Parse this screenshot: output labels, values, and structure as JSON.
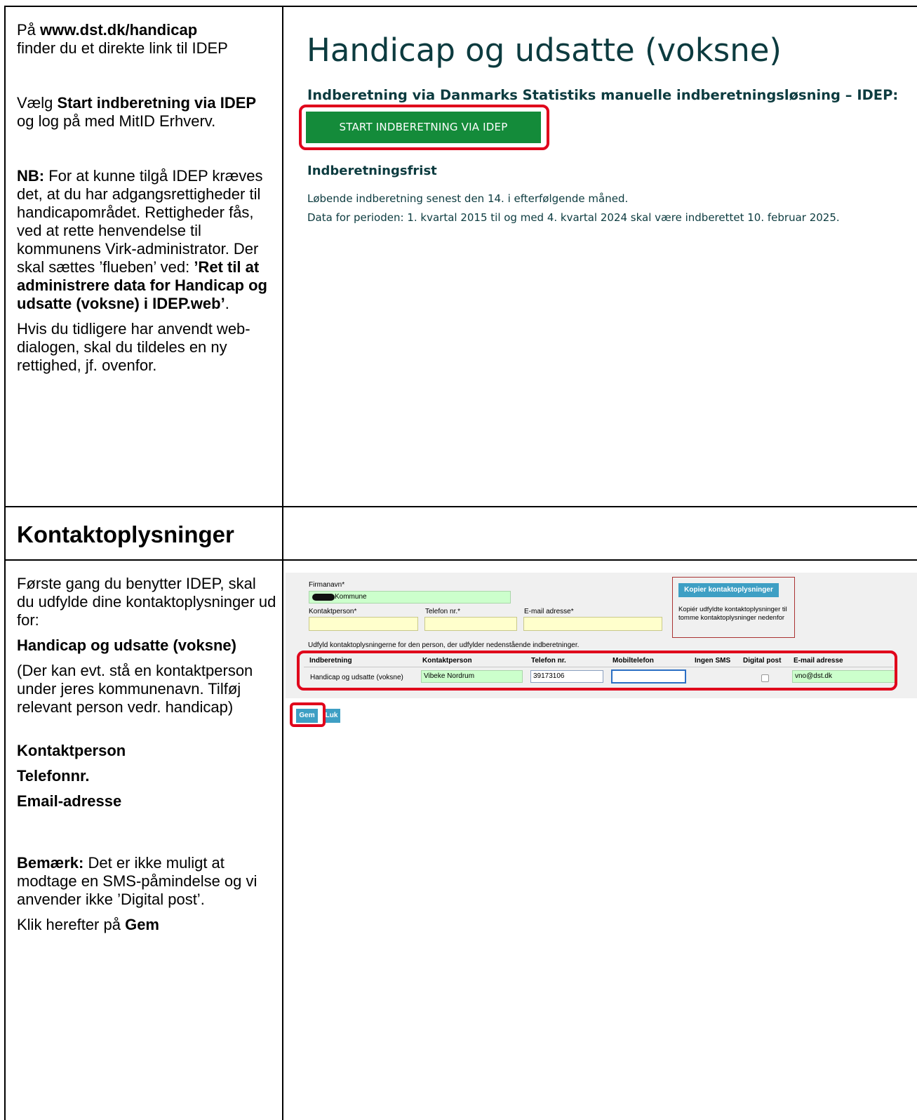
{
  "left_top": {
    "p1_prefix": "På ",
    "p1_url": "www.dst.dk/handicap",
    "p1_rest": "finder du et direkte link til IDEP",
    "p2_prefix": "Vælg ",
    "p2_bold": "Start indberetning via IDEP",
    "p2_rest": " og log på med MitID Erhverv.",
    "p3_bold": "NB:",
    "p3_text": " For at kunne tilgå IDEP kræves det, at du har adgangsrettigheder til handicapområdet. Rettigheder fås, ved at rette henvendelse til kommunens Virk-administrator. Der skal sættes ’flueben’ ved: ",
    "p3_bold2": "’Ret til at administrere data for Handicap og udsatte (voksne) i IDEP.web’",
    "p3_end": ".",
    "p4": "Hvis du tidligere har anvendt web-dialogen, skal du tildeles en ny rettighed, jf. ovenfor."
  },
  "section_heading": "Kontaktoplysninger",
  "left_bottom": {
    "p1": "Første gang du benytter IDEP, skal du udfylde dine kontaktoplysninger ud for:",
    "p2": "Handicap og udsatte (voksne)",
    "p3": "(Der kan evt. stå en kontaktperson under jeres kommunenavn. Tilføj relevant person vedr. handicap)",
    "f1": "Kontaktperson",
    "f2": "Telefonnr.",
    "f3": "Email-adresse",
    "p4_bold": "Bemærk:",
    "p4_text": " Det er ikke muligt at modtage en SMS-påmindelse og vi anvender ikke ’Digital post’.",
    "p5_prefix": "Klik herefter på ",
    "p5_bold": "Gem"
  },
  "web": {
    "title": "Handicap og udsatte (voksne)",
    "idep_heading": "Indberetning via Danmarks Statistiks manuelle indberetningsløsning – IDEP:",
    "start_button": "START INDBERETNING VIA IDEP",
    "frist_heading": "Indberetningsfrist",
    "frist_line1": "Løbende indberetning senest den 14. i efterfølgende måned.",
    "frist_line2": "Data for perioden: 1. kvartal 2015 til og med 4. kvartal 2024 skal være indberettet 10. februar 2025."
  },
  "form": {
    "firmanavn_label": "Firmanavn*",
    "firmanavn_value": "Kommune",
    "kontaktperson_label": "Kontaktperson*",
    "telefon_label": "Telefon nr.*",
    "email_label": "E-mail adresse*",
    "copy_button": "Kopier kontaktoplysninger",
    "copy_text": "Kopiér udfyldte kontaktoplysninger til tomme kontaktoplysninger nedenfor",
    "instruction": "Udfyld kontaktoplysningerne for den person, der udfylder nedenstående indberetninger.",
    "headers": [
      "Indberetning",
      "Kontaktperson",
      "Telefon nr.",
      "Mobiltelefon",
      "Ingen SMS",
      "Digital post",
      "E-mail adresse"
    ],
    "row": {
      "indberetning": "Handicap og udsatte (voksne)",
      "kontaktperson": "Vibeke Nordrum",
      "telefon": "39173106",
      "mobil": "",
      "email": "vno@dst.dk"
    },
    "gem": "Gem",
    "luk": "Luk"
  },
  "colors": {
    "title_color": "#0c3b3f",
    "start_button_bg": "#148b3a",
    "highlight_red": "#e0001b",
    "idep_button_blue": "#3e9fc4"
  }
}
